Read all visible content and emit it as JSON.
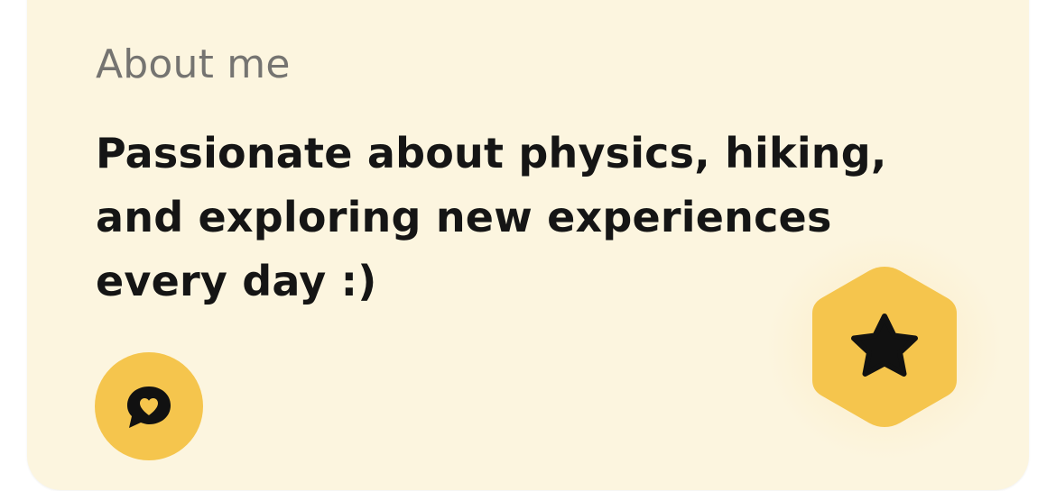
{
  "about": {
    "label": "About me",
    "text": "Passionate about physics, hiking, and exploring new experiences every day :)"
  },
  "actions": {
    "compliment_icon": "chat-heart-icon",
    "superswipe_icon": "star-icon"
  },
  "colors": {
    "card_background": "#FCF5DF",
    "accent_yellow": "#F5C54D",
    "label_gray": "#757471",
    "text_dark": "#151515"
  }
}
